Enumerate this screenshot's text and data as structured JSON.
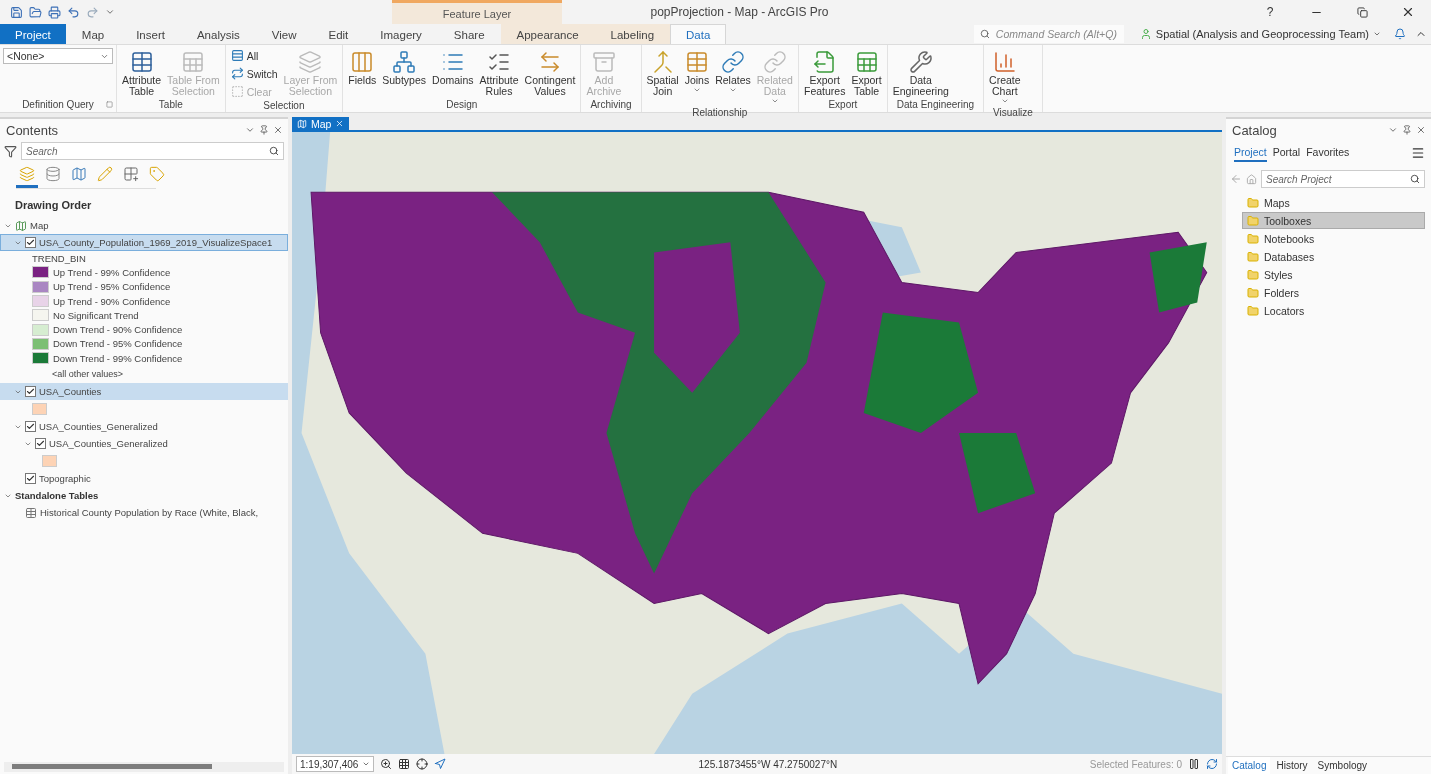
{
  "window": {
    "title": "popProjection - Map - ArcGIS Pro",
    "help": "?"
  },
  "contextual_group": {
    "label": "Feature Layer"
  },
  "tabs": [
    {
      "label": "Project",
      "selected": false,
      "kind": "backstage"
    },
    {
      "label": "Map",
      "selected": false,
      "kind": "core"
    },
    {
      "label": "Insert",
      "selected": false,
      "kind": "core"
    },
    {
      "label": "Analysis",
      "selected": false,
      "kind": "core"
    },
    {
      "label": "View",
      "selected": false,
      "kind": "core"
    },
    {
      "label": "Edit",
      "selected": false,
      "kind": "core"
    },
    {
      "label": "Imagery",
      "selected": false,
      "kind": "core"
    },
    {
      "label": "Share",
      "selected": false,
      "kind": "core"
    },
    {
      "label": "Appearance",
      "selected": false,
      "kind": "contextual"
    },
    {
      "label": "Labeling",
      "selected": false,
      "kind": "contextual"
    },
    {
      "label": "Data",
      "selected": true,
      "kind": "contextual"
    }
  ],
  "command_search": {
    "placeholder": "Command Search (Alt+Q)"
  },
  "account": {
    "label": "Spatial (Analysis and Geoprocessing Team)"
  },
  "ribbon": [
    {
      "title": "Definition Query",
      "launcher": true,
      "items": [
        {
          "kind": "dropdown",
          "lines": [
            "<None>"
          ],
          "disabled": false
        }
      ]
    },
    {
      "title": "Table",
      "launcher": false,
      "items": [
        {
          "kind": "large",
          "lines": [
            "Attribute",
            "Table"
          ],
          "disabled": false
        },
        {
          "kind": "large",
          "lines": [
            "Table From",
            "Selection"
          ],
          "disabled": true
        }
      ]
    },
    {
      "title": "Selection",
      "launcher": false,
      "items": [
        {
          "kind": "small",
          "lines": [
            "All"
          ],
          "disabled": false
        },
        {
          "kind": "small",
          "lines": [
            "Switch"
          ],
          "disabled": false
        },
        {
          "kind": "small",
          "lines": [
            "Clear"
          ],
          "disabled": true
        },
        {
          "kind": "large",
          "lines": [
            "Layer From",
            "Selection"
          ],
          "disabled": true
        }
      ]
    },
    {
      "title": "Design",
      "launcher": false,
      "items": [
        {
          "kind": "large",
          "lines": [
            "Fields"
          ],
          "disabled": false
        },
        {
          "kind": "large",
          "lines": [
            "Subtypes"
          ],
          "disabled": false
        },
        {
          "kind": "large",
          "lines": [
            "Domains"
          ],
          "disabled": false
        },
        {
          "kind": "large",
          "lines": [
            "Attribute",
            "Rules"
          ],
          "disabled": false
        },
        {
          "kind": "large",
          "lines": [
            "Contingent",
            "Values"
          ],
          "disabled": false
        }
      ]
    },
    {
      "title": "Archiving",
      "launcher": false,
      "items": [
        {
          "kind": "large",
          "lines": [
            "Add",
            "Archive"
          ],
          "disabled": true
        }
      ]
    },
    {
      "title": "Relationship",
      "launcher": false,
      "items": [
        {
          "kind": "large",
          "lines": [
            "Spatial",
            "Join"
          ],
          "disabled": false
        },
        {
          "kind": "large",
          "lines": [
            "Joins"
          ],
          "disabled": false,
          "menu": true
        },
        {
          "kind": "large",
          "lines": [
            "Relates"
          ],
          "disabled": false,
          "menu": true
        },
        {
          "kind": "large",
          "lines": [
            "Related",
            "Data"
          ],
          "disabled": true,
          "menu": true
        }
      ]
    },
    {
      "title": "Export",
      "launcher": false,
      "items": [
        {
          "kind": "large",
          "lines": [
            "Export",
            "Features"
          ],
          "disabled": false
        },
        {
          "kind": "large",
          "lines": [
            "Export",
            "Table"
          ],
          "disabled": false
        }
      ]
    },
    {
      "title": "Data Engineering",
      "launcher": false,
      "items": [
        {
          "kind": "large",
          "lines": [
            "Data",
            "Engineering"
          ],
          "disabled": false
        }
      ]
    },
    {
      "title": "Visualize",
      "launcher": false,
      "items": [
        {
          "kind": "large",
          "lines": [
            "Create",
            "Chart"
          ],
          "disabled": false,
          "menu": true
        }
      ]
    }
  ],
  "contents": {
    "title": "Contents",
    "search": {
      "placeholder": "Search"
    },
    "view_tabs": [
      {
        "selected": true
      },
      {
        "selected": false
      },
      {
        "selected": false
      },
      {
        "selected": false
      },
      {
        "selected": false
      },
      {
        "selected": false
      }
    ],
    "heading": "Drawing Order",
    "tree": [
      {
        "kind": "map",
        "label": "Map",
        "expanded": true,
        "children": [
          {
            "kind": "layer",
            "label": "USA_County_Population_1969_2019_VisualizeSpace1",
            "checked": true,
            "selected": true,
            "expanded": true,
            "focused": true,
            "legend": {
              "field": "TREND_BIN",
              "classes": [
                {
                  "label": "Up Trend - 99% Confidence",
                  "color": "#7a2282"
                },
                {
                  "label": "Up Trend - 95% Confidence",
                  "color": "#a986c2"
                },
                {
                  "label": "Up Trend - 90% Confidence",
                  "color": "#e8d3e8"
                },
                {
                  "label": "No Significant Trend",
                  "color": "#f5f5ef"
                },
                {
                  "label": "Down Trend - 90% Confidence",
                  "color": "#d6edd1"
                },
                {
                  "label": "Down Trend - 95% Confidence",
                  "color": "#7cbf74"
                },
                {
                  "label": "Down Trend - 99% Confidence",
                  "color": "#1b7a38"
                }
              ],
              "other": "<all other values>"
            }
          },
          {
            "kind": "layer",
            "label": "USA_Counties",
            "checked": true,
            "selected": true,
            "expanded": true,
            "focused": false,
            "color": "#fdd3b5"
          },
          {
            "kind": "group",
            "label": "USA_Counties_Generalized",
            "checked": true,
            "selected": false,
            "expanded": true,
            "focused": false,
            "children": [
              {
                "kind": "layer",
                "label": "USA_Counties_Generalized",
                "checked": true,
                "selected": false,
                "expanded": true,
                "focused": false,
                "color": "#fdd3b5"
              }
            ]
          },
          {
            "kind": "basemap",
            "label": "Topographic",
            "checked": true,
            "selected": false,
            "focused": false
          }
        ]
      },
      {
        "kind": "tables",
        "label": "Standalone Tables",
        "expanded": true,
        "children": [
          {
            "kind": "table",
            "label": "Historical County Population by Race (White, Black,"
          }
        ]
      }
    ]
  },
  "map_view": {
    "tab": "Map",
    "scale": "1:19,307,406",
    "coordinates": "125.1873455°W 47.2750027°N",
    "selected_features": "Selected Features: 0"
  },
  "catalog": {
    "title": "Catalog",
    "tabs": [
      {
        "label": "Project",
        "selected": true
      },
      {
        "label": "Portal",
        "selected": false
      },
      {
        "label": "Favorites",
        "selected": false
      }
    ],
    "search": {
      "placeholder": "Search Project"
    },
    "items": [
      {
        "label": "Maps",
        "selected": false
      },
      {
        "label": "Toolboxes",
        "selected": true
      },
      {
        "label": "Notebooks",
        "selected": false
      },
      {
        "label": "Databases",
        "selected": false
      },
      {
        "label": "Styles",
        "selected": false
      },
      {
        "label": "Folders",
        "selected": false
      },
      {
        "label": "Locators",
        "selected": false
      }
    ]
  },
  "bottom_tabs": [
    {
      "label": "Catalog",
      "selected": true
    },
    {
      "label": "History",
      "selected": false
    },
    {
      "label": "Symbology",
      "selected": false
    }
  ]
}
